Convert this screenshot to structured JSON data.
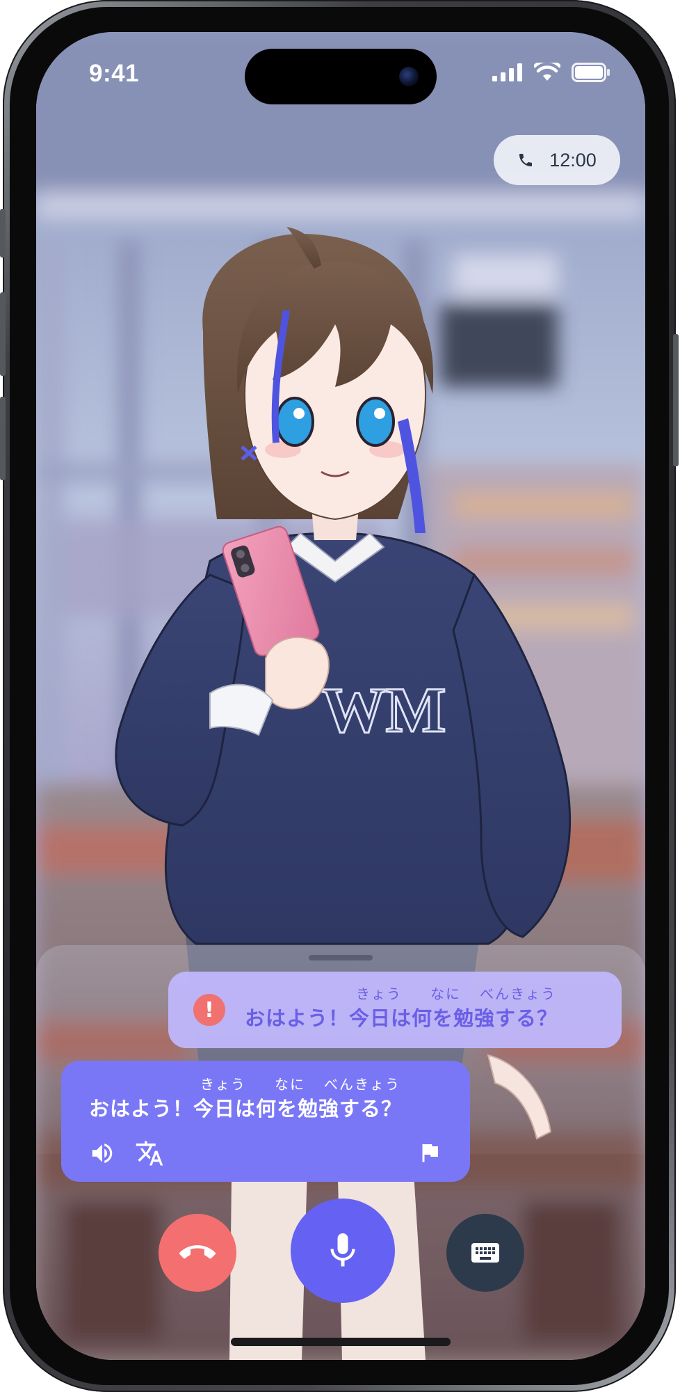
{
  "status_bar": {
    "time": "9:41",
    "icons": [
      "cellular-signal-icon",
      "wifi-icon",
      "battery-icon"
    ]
  },
  "call": {
    "timer": "12:00",
    "timer_icon": "phone-icon"
  },
  "user_message": {
    "status": "error",
    "ruby": [
      "きょう",
      "なに",
      "べんきょう"
    ],
    "text": "おはよう！今日は何を勉強する？",
    "status_icon": "error-icon"
  },
  "ai_message": {
    "ruby": [
      "きょう",
      "なに",
      "べんきょう"
    ],
    "text": "おはよう！今日は何を勉強する？",
    "actions": [
      "speaker-icon",
      "translate-icon",
      "flag-icon"
    ]
  },
  "controls": {
    "end_call": "end-call-icon",
    "microphone": "microphone-icon",
    "keyboard": "keyboard-icon"
  },
  "colors": {
    "accent": "#6461f3",
    "ai_bubble": "#7a77f7",
    "user_bubble": "#bdb6fa",
    "user_text": "#6a5fe6",
    "end_call": "#f46f6f",
    "keyboard_button": "#2d3a4c",
    "error": "#f07170"
  }
}
